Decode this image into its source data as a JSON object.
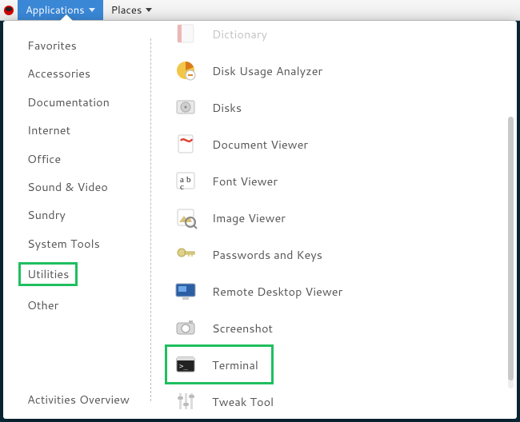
{
  "topbar": {
    "applications_label": "Applications",
    "places_label": "Places"
  },
  "sidebar": {
    "categories": [
      {
        "label": "Favorites",
        "highlighted": false
      },
      {
        "label": "Accessories",
        "highlighted": false
      },
      {
        "label": "Documentation",
        "highlighted": false
      },
      {
        "label": "Internet",
        "highlighted": false
      },
      {
        "label": "Office",
        "highlighted": false
      },
      {
        "label": "Sound & Video",
        "highlighted": false
      },
      {
        "label": "Sundry",
        "highlighted": false
      },
      {
        "label": "System Tools",
        "highlighted": false
      },
      {
        "label": "Utilities",
        "highlighted": true
      },
      {
        "label": "Other",
        "highlighted": false
      }
    ],
    "overview_label": "Activities Overview"
  },
  "apps": [
    {
      "label": "Dictionary",
      "icon": "dictionary-icon",
      "cutoff": true,
      "highlighted": false
    },
    {
      "label": "Disk Usage Analyzer",
      "icon": "disk-usage-icon",
      "cutoff": false,
      "highlighted": false
    },
    {
      "label": "Disks",
      "icon": "disks-icon",
      "cutoff": false,
      "highlighted": false
    },
    {
      "label": "Document Viewer",
      "icon": "document-viewer-icon",
      "cutoff": false,
      "highlighted": false
    },
    {
      "label": "Font Viewer",
      "icon": "font-viewer-icon",
      "cutoff": false,
      "highlighted": false
    },
    {
      "label": "Image Viewer",
      "icon": "image-viewer-icon",
      "cutoff": false,
      "highlighted": false
    },
    {
      "label": "Passwords and Keys",
      "icon": "passwords-keys-icon",
      "cutoff": false,
      "highlighted": false
    },
    {
      "label": "Remote Desktop Viewer",
      "icon": "remote-desktop-icon",
      "cutoff": false,
      "highlighted": false
    },
    {
      "label": "Screenshot",
      "icon": "screenshot-icon",
      "cutoff": false,
      "highlighted": false
    },
    {
      "label": "Terminal",
      "icon": "terminal-icon",
      "cutoff": false,
      "highlighted": true
    },
    {
      "label": "Tweak Tool",
      "icon": "tweak-tool-icon",
      "cutoff": false,
      "highlighted": false
    }
  ],
  "highlight_color": "#1fbf5f"
}
